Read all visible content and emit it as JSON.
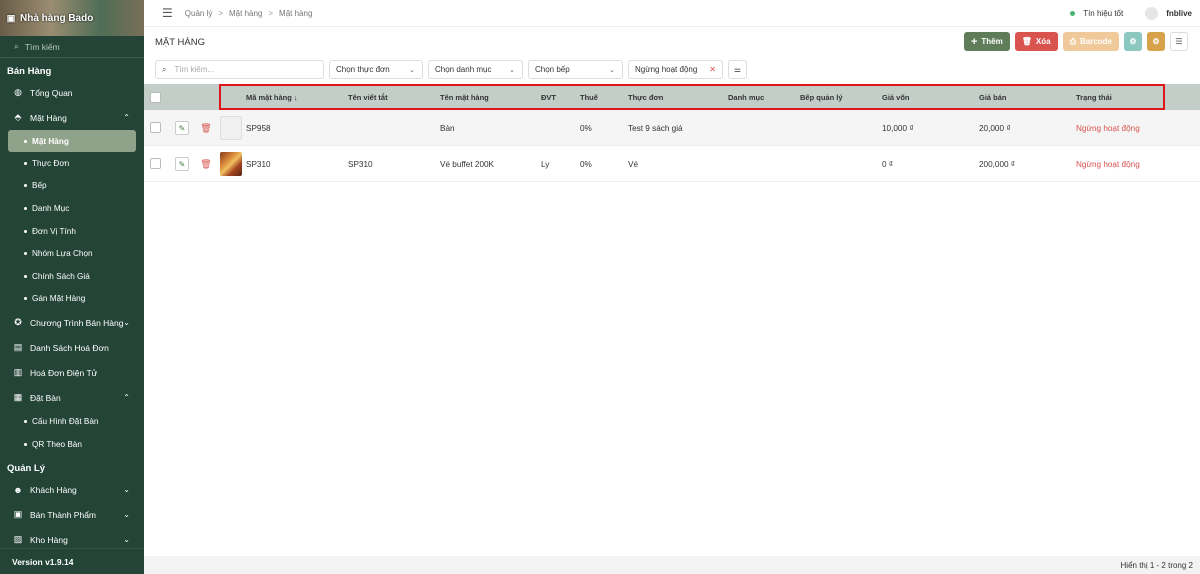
{
  "sidebar": {
    "brand": "Nhà hàng Bado",
    "search_placeholder": "Tìm kiếm",
    "sections": [
      {
        "title": "Bán Hàng"
      },
      {
        "title": "Quản Lý"
      }
    ],
    "items": {
      "tong_quan": "Tổng Quan",
      "mat_hang": "Mặt Hàng",
      "sub_mat_hang": "Mặt Hàng",
      "thuc_don": "Thực Đơn",
      "bep": "Bếp",
      "danh_muc": "Danh Mục",
      "don_vi_tinh": "Đơn Vị Tính",
      "nhom_lua_chon": "Nhóm Lựa Chọn",
      "chinh_sach_gia": "Chính Sách Giá",
      "gan_mat_hang": "Gán Mặt Hàng",
      "chuong_trinh": "Chương Trình Bán Hàng",
      "danh_sach_hoa_don": "Danh Sách Hoá Đơn",
      "hoa_don_dien_tu": "Hoá Đơn Điện Tử",
      "dat_ban": "Đặt Bàn",
      "cau_hinh_dat_ban": "Cấu Hình Đặt Bàn",
      "qr_theo_ban": "QR Theo Bàn",
      "khach_hang": "Khách Hàng",
      "ban_thanh_pham": "Bán Thành Phẩm",
      "kho_hang": "Kho Hàng"
    },
    "version": "Version v1.9.14"
  },
  "topbar": {
    "breadcrumb": [
      "Quản lý",
      "Mặt hàng",
      "Mặt hàng"
    ],
    "signal": "Tín hiệu tốt",
    "user": "fnblive"
  },
  "page": {
    "title": "MẶT HÀNG",
    "actions": {
      "add": "Thêm",
      "delete": "Xóa",
      "barcode": "Barcode"
    }
  },
  "filters": {
    "search_placeholder": "Tìm kiếm...",
    "menu": "Chọn thực đơn",
    "category": "Chọn danh mục",
    "kitchen": "Chọn bếp",
    "status_tag": "Ngừng hoạt động"
  },
  "table": {
    "headers": {
      "code": "Mã mặt hàng ↓",
      "short": "Tên viết tắt",
      "name": "Tên mặt hàng",
      "unit": "ĐVT",
      "tax": "Thuế",
      "menu": "Thực đơn",
      "category": "Danh mục",
      "kitchen": "Bếp quản lý",
      "cost": "Giá vốn",
      "price": "Giá bán",
      "status": "Trạng thái"
    },
    "rows": [
      {
        "code": "SP958",
        "short": "",
        "name": "Bàn",
        "unit": "",
        "tax": "0%",
        "menu": "Test 9 sách giá",
        "category": "",
        "kitchen": "",
        "cost": "10,000 ₫",
        "price": "20,000 ₫",
        "status": "Ngừng hoạt động"
      },
      {
        "code": "SP310",
        "short": "SP310",
        "name": "Vé buffet 200K",
        "unit": "Ly",
        "tax": "0%",
        "menu": "Vé",
        "category": "",
        "kitchen": "",
        "cost": "0 ₫",
        "price": "200,000 ₫",
        "status": "Ngừng hoạt động"
      }
    ]
  },
  "footer": {
    "pagination": "Hiển thị 1 - 2 trong 2"
  },
  "colors": {
    "sidebar_bg": "#234437",
    "accent_green": "#5e7d58",
    "danger": "#d9534f",
    "highlight_border": "#e0141b"
  }
}
